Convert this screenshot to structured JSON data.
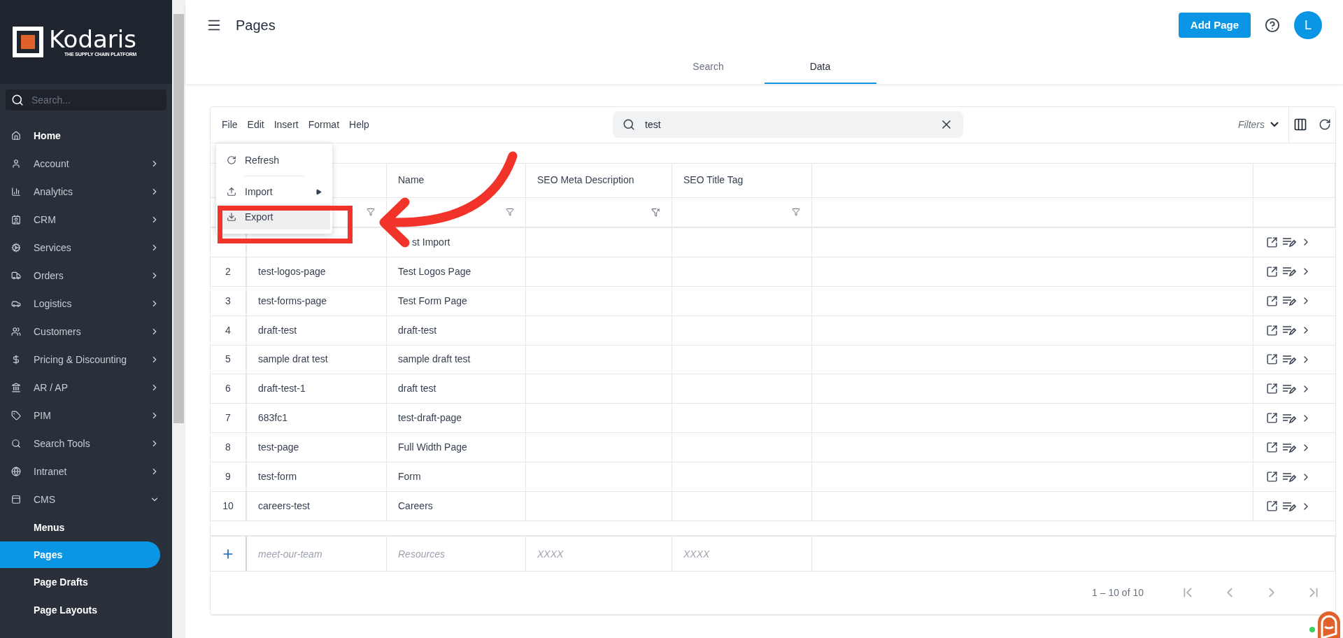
{
  "sidebar": {
    "logo": {
      "name": "Kodaris",
      "tagline": "THE SUPPLY CHAIN PLATFORM"
    },
    "search": {
      "placeholder": "Search..."
    },
    "items": [
      {
        "label": "Home",
        "kind": "link"
      },
      {
        "label": "Account",
        "kind": "group",
        "expanded": false
      },
      {
        "label": "Analytics",
        "kind": "group",
        "expanded": false
      },
      {
        "label": "CRM",
        "kind": "group",
        "expanded": false
      },
      {
        "label": "Services",
        "kind": "group",
        "expanded": false
      },
      {
        "label": "Orders",
        "kind": "group",
        "expanded": false
      },
      {
        "label": "Logistics",
        "kind": "group",
        "expanded": false
      },
      {
        "label": "Customers",
        "kind": "group",
        "expanded": false
      },
      {
        "label": "Pricing & Discounting",
        "kind": "group",
        "expanded": false
      },
      {
        "label": "AR / AP",
        "kind": "group",
        "expanded": false
      },
      {
        "label": "PIM",
        "kind": "group",
        "expanded": false
      },
      {
        "label": "Search Tools",
        "kind": "group",
        "expanded": false
      },
      {
        "label": "Intranet",
        "kind": "group",
        "expanded": false
      },
      {
        "label": "CMS",
        "kind": "group",
        "expanded": true,
        "children": [
          {
            "label": "Menus",
            "selected": false
          },
          {
            "label": "Pages",
            "selected": true
          },
          {
            "label": "Page Drafts",
            "selected": false
          },
          {
            "label": "Page Layouts",
            "selected": false
          }
        ]
      }
    ]
  },
  "header": {
    "title": "Pages",
    "add_button": "Add Page",
    "avatar": "L"
  },
  "tabs": [
    {
      "label": "Search",
      "selected": false
    },
    {
      "label": "Data",
      "selected": true
    }
  ],
  "toolbar": {
    "menus": [
      "File",
      "Edit",
      "Insert",
      "Format",
      "Help"
    ],
    "search": {
      "value": "test"
    },
    "filters": "Filters"
  },
  "file_menu": [
    {
      "kind": "item",
      "label": "Refresh",
      "selected": false
    },
    {
      "kind": "divider"
    },
    {
      "kind": "submenu",
      "label": "Import",
      "selected": false
    },
    {
      "kind": "item",
      "label": "Export",
      "selected": true
    }
  ],
  "table": {
    "columns": [
      {
        "kind": "filter"
      },
      {
        "label": "Name",
        "kind": "filter"
      },
      {
        "label": "SEO Meta Description",
        "kind": "cleared-filter"
      },
      {
        "label": "SEO Title Tag",
        "kind": "filter"
      }
    ],
    "rows": [
      {
        "name": "st Import"
      },
      {
        "index": "2",
        "slug": "test-logos-page",
        "name": "Test Logos Page"
      },
      {
        "index": "3",
        "slug": "test-forms-page",
        "name": "Test Form Page"
      },
      {
        "index": "4",
        "slug": "draft-test",
        "name": "draft-test"
      },
      {
        "index": "5",
        "slug": "sample drat test",
        "name": "sample draft test"
      },
      {
        "index": "6",
        "slug": "draft-test-1",
        "name": "draft test"
      },
      {
        "index": "7",
        "slug": "683fc1",
        "name": "test-draft-page"
      },
      {
        "index": "8",
        "slug": "test-page",
        "name": "Full Width Page"
      },
      {
        "index": "9",
        "slug": "test-form",
        "name": "Form"
      },
      {
        "index": "10",
        "slug": "careers-test",
        "name": "Careers"
      }
    ],
    "new_row": [
      {
        "placeholder": "meet-our-team"
      },
      {
        "placeholder": "Resources"
      },
      {
        "placeholder": "XXXX"
      },
      {
        "placeholder": "XXXX"
      }
    ]
  },
  "pagination": {
    "range": "1 – 10 of 10"
  }
}
